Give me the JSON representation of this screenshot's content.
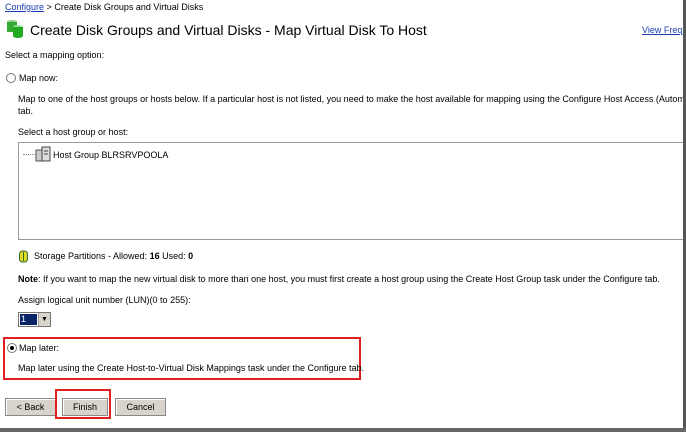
{
  "breadcrumb": {
    "link": "Configure",
    "sep": ">",
    "current": "Create Disk Groups and Virtual Disks"
  },
  "header": {
    "title": "Create Disk Groups and Virtual Disks - Map Virtual Disk To Host",
    "help_link": "View Frequ"
  },
  "select_label": "Select a mapping option:",
  "map_now": {
    "label": "Map now:",
    "selected": false,
    "desc1": "Map to one of the host groups or hosts below.  If a particular host is not listed, you need to make the host available for mapping using the Configure Host Access (Automatic) ta",
    "desc2": "tab.",
    "host_label": "Select a host group or host:",
    "hosts": [
      "Host Group BLRSRVPOOLA"
    ]
  },
  "storage": {
    "label": "Storage Partitions - Allowed:",
    "allowed": "16",
    "used_label": "Used:",
    "used": "0"
  },
  "note": {
    "bold": "Note",
    "text": ": If you want to map the new virtual disk to more than one host, you must first create a host group using the Create Host Group task under the Configure tab."
  },
  "lun": {
    "label": "Assign logical unit number (LUN)(0 to 255):",
    "value": "1"
  },
  "map_later": {
    "label": "Map later:",
    "selected": true,
    "desc": "Map later using the Create Host-to-Virtual Disk Mappings task under the Configure tab."
  },
  "buttons": {
    "back": "< Back",
    "finish": "Finish",
    "cancel": "Cancel"
  },
  "colors": {
    "highlight": "#e02020",
    "link": "#1a3cb0"
  }
}
